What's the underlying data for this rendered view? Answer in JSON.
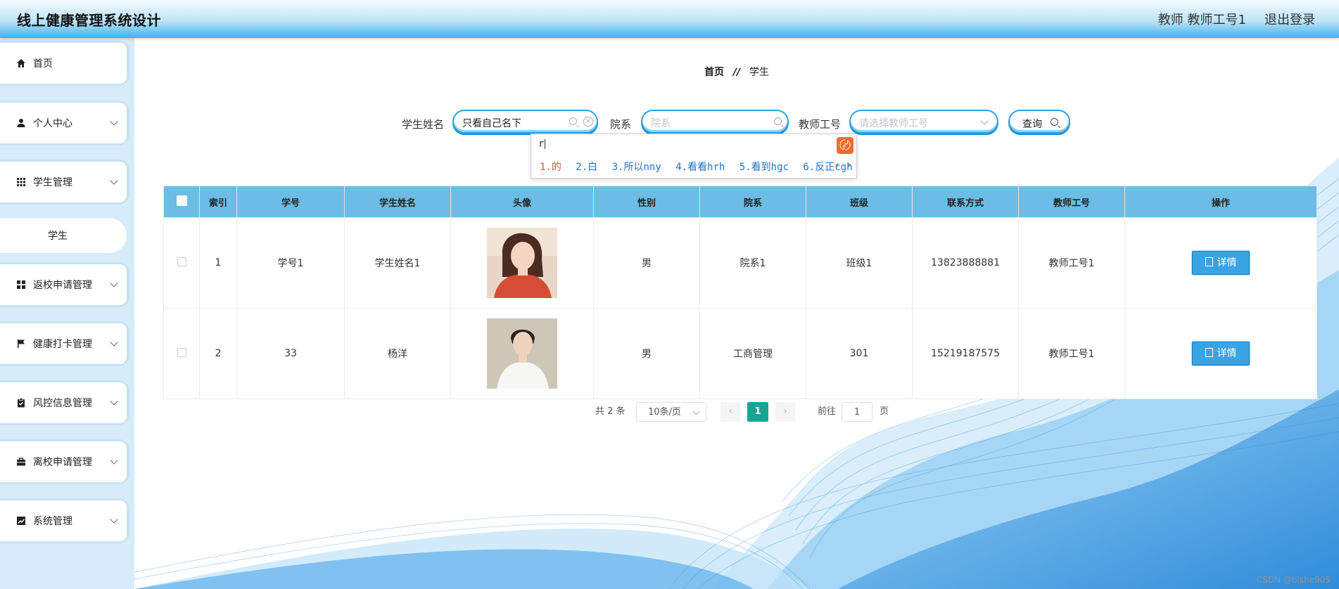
{
  "header": {
    "title": "线上健康管理系统设计",
    "user": "教师 教师工号1",
    "logout": "退出登录"
  },
  "sidebar": {
    "items": [
      {
        "label": "首页",
        "icon": "home-icon"
      },
      {
        "label": "个人中心",
        "icon": "user-icon"
      },
      {
        "label": "学生管理",
        "icon": "grid-icon"
      },
      {
        "label": "学生",
        "icon": ""
      },
      {
        "label": "返校申请管理",
        "icon": "apps-icon"
      },
      {
        "label": "健康打卡管理",
        "icon": "flag-icon"
      },
      {
        "label": "风控信息管理",
        "icon": "clipboard-icon"
      },
      {
        "label": "离校申请管理",
        "icon": "briefcase-icon"
      },
      {
        "label": "系统管理",
        "icon": "chart-icon"
      }
    ]
  },
  "breadcrumb": {
    "home": "首页",
    "sep": "//",
    "current": "学生"
  },
  "search": {
    "name_label": "学生姓名",
    "name_value": "只看自己名下",
    "dept_label": "院系",
    "dept_placeholder": "院系",
    "teacher_label": "教师工号",
    "teacher_placeholder": "请选择教师工号",
    "query_label": "查询"
  },
  "ime": {
    "pinyin": "r",
    "candidates": [
      "1.的",
      "2.白",
      "3.所以nny",
      "4.看看hrh",
      "5.看到hgc",
      "6.反正cgh"
    ]
  },
  "table": {
    "headers": [
      "索引",
      "学号",
      "学生姓名",
      "头像",
      "性别",
      "院系",
      "班级",
      "联系方式",
      "教师工号",
      "操作"
    ],
    "rows": [
      {
        "index": "1",
        "id": "学号1",
        "name": "学生姓名1",
        "gender": "男",
        "dept": "院系1",
        "class": "班级1",
        "phone": "13823888881",
        "teacher": "教师工号1",
        "action": "详情"
      },
      {
        "index": "2",
        "id": "33",
        "name": "杨洋",
        "gender": "男",
        "dept": "工商管理",
        "class": "301",
        "phone": "15219187575",
        "teacher": "教师工号1",
        "action": "详情"
      }
    ]
  },
  "pagination": {
    "total": "共 2 条",
    "page_size": "10条/页",
    "current_page": "1",
    "goto_label": "前往",
    "goto_value": "1",
    "page_suffix": "页"
  },
  "watermark": "CSDN @bishe905",
  "colors": {
    "accent": "#2ea3e0",
    "table_header": "#6bbde5",
    "pager_active": "#1aa394",
    "detail_button": "#3aa3e3"
  }
}
